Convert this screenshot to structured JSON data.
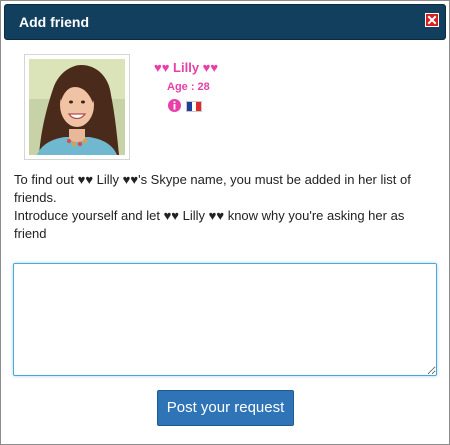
{
  "dialog": {
    "title": "Add friend",
    "close_icon": "close-icon"
  },
  "profile": {
    "name": "♥♥ Lilly ♥♥",
    "age": "Age : 28",
    "info_icon": "info-icon",
    "flag_icon": "france-flag-icon",
    "accent_color": "#e83fa8"
  },
  "message": {
    "line1": "To find out ♥♥ Lilly ♥♥'s Skype name, you must be added in her list of friends.",
    "line2": "Introduce yourself and let ♥♥ Lilly ♥♥ know why you're asking her as friend"
  },
  "form": {
    "textarea_value": "",
    "submit_label": "Post your request"
  },
  "colors": {
    "titlebar": "#123f5e",
    "button": "#2f74b6",
    "close": "#d61f1f",
    "focus_border": "#4aa7dc"
  }
}
